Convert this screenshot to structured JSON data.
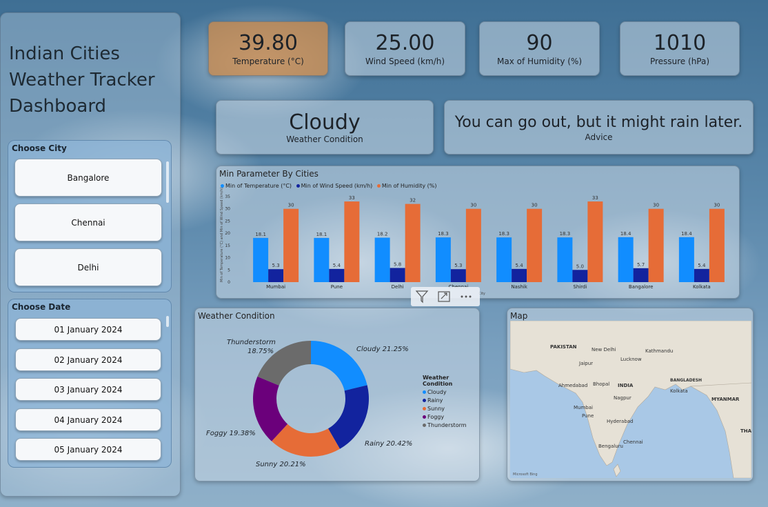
{
  "app": {
    "title_lines": [
      "Indian Cities",
      "Weather Tracker",
      "Dashboard"
    ]
  },
  "city_slicer": {
    "title": "Choose City",
    "items": [
      "Bangalore",
      "Chennai",
      "Delhi"
    ]
  },
  "date_slicer": {
    "title": "Choose Date",
    "items": [
      "01 January 2024",
      "02 January 2024",
      "03 January 2024",
      "04 January 2024",
      "05 January 2024"
    ]
  },
  "kpis": [
    {
      "value": "39.80",
      "label": "Temperature (°C)",
      "color": "#c98b4f"
    },
    {
      "value": "25.00",
      "label": "Wind Speed (km/h)"
    },
    {
      "value": "90",
      "label": "Max of Humidity (%)"
    },
    {
      "value": "1010",
      "label": "Pressure (hPa)"
    }
  ],
  "condition": {
    "value": "Cloudy",
    "label": "Weather Condition"
  },
  "advice": {
    "value": "You can go out, but it might rain later.",
    "label": "Advice"
  },
  "colors": {
    "temperature": "#118dff",
    "wind": "#12239e",
    "humidity": "#e66c37",
    "cloudy": "#118dff",
    "rainy": "#12239e",
    "sunny": "#e66c37",
    "foggy": "#6b007b",
    "thunderstorm": "#6b6b6b"
  },
  "visual_header_icons": [
    "filter-icon",
    "focus-mode-icon",
    "more-options-icon"
  ],
  "chart_data": [
    {
      "type": "bar",
      "title": "Min Parameter By Cities",
      "xlabel": "City",
      "ylabel": "Min of Temperature (°C) and Min of Wind Speed (km/h)",
      "ylim": [
        0,
        35
      ],
      "yticks": [
        0,
        5,
        10,
        15,
        20,
        25,
        30,
        35
      ],
      "categories": [
        "Mumbai",
        "Pune",
        "Delhi",
        "Chennai",
        "Nashik",
        "Shirdi",
        "Bangalore",
        "Kolkata"
      ],
      "series": [
        {
          "name": "Min of Temperature (°C)",
          "values": [
            18.1,
            18.1,
            18.2,
            18.3,
            18.3,
            18.3,
            18.4,
            18.4
          ],
          "labels": [
            "18.1",
            "18.1",
            "18.2",
            "18.3",
            "18.3",
            "18.3",
            "18.4",
            "18.4"
          ]
        },
        {
          "name": "Min of Wind Speed (km/h)",
          "values": [
            5.3,
            5.4,
            5.8,
            5.3,
            5.4,
            5.0,
            5.7,
            5.4
          ],
          "labels": [
            "5.3",
            "5.4",
            "5.8",
            "5.3",
            "5.4",
            "5.0",
            "5.7",
            "5.4"
          ]
        },
        {
          "name": "Min of Humidity (%)",
          "values": [
            30,
            33,
            32,
            30,
            30,
            33,
            30,
            30
          ],
          "labels": [
            "30",
            "33",
            "32",
            "30",
            "30",
            "33",
            "30",
            "30"
          ]
        }
      ],
      "legend_position": "top-left",
      "grid": false
    },
    {
      "type": "pie",
      "donut": true,
      "title": "Weather Condition",
      "legend_title": "Weather Condition",
      "legend_position": "right",
      "slices": [
        {
          "name": "Cloudy",
          "value": 21.25,
          "label": "Cloudy 21.25%"
        },
        {
          "name": "Rainy",
          "value": 20.42,
          "label": "Rainy 20.42%"
        },
        {
          "name": "Sunny",
          "value": 20.21,
          "label": "Sunny 20.21%"
        },
        {
          "name": "Foggy",
          "value": 19.38,
          "label": "Foggy 19.38%"
        },
        {
          "name": "Thunderstorm",
          "value": 18.75,
          "label_lines": [
            "Thunderstorm",
            "18.75%"
          ]
        }
      ]
    }
  ],
  "map": {
    "title": "Map",
    "labels": [
      "PAKISTAN",
      "New Delhi",
      "INDIA",
      "BANGLADESH",
      "MYANMAR",
      "Mumbai",
      "Chennai",
      "Bengaluru",
      "Kolkata",
      "Hyderabad",
      "Nagpur",
      "Pune",
      "Jaipur",
      "Lucknow",
      "Ahmedabad",
      "Bhopal",
      "Kathmandu",
      "THA"
    ],
    "attribution": "Microsoft Bing"
  }
}
